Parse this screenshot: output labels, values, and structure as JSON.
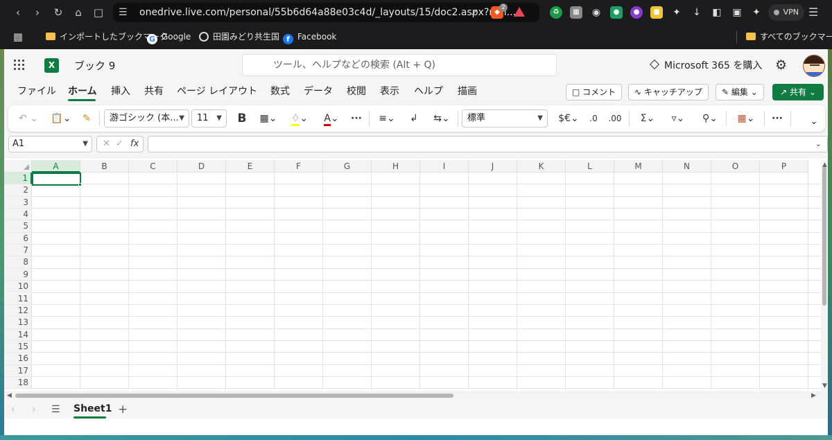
{
  "browser": {
    "url": "onedrive.live.com/personal/55b6d64a88e03c4d/_layouts/15/doc2.aspx?resi...",
    "brave_badge": "2",
    "vpn_label": "VPN",
    "bookmarks": [
      {
        "label": "インポートしたブックマーク"
      },
      {
        "label": "Google"
      },
      {
        "label": "田園みどり共生国"
      },
      {
        "label": "Facebook"
      }
    ],
    "all_bookmarks": "すべてのブックマーク"
  },
  "app": {
    "doc_name": "ブック 9",
    "search_placeholder": "ツール、ヘルプなどの検索 (Alt + Q)",
    "buy_label": "Microsoft 365 を購入",
    "tabs": [
      "ファイル",
      "ホーム",
      "挿入",
      "共有",
      "ページ レイアウト",
      "数式",
      "データ",
      "校閲",
      "表示",
      "ヘルプ",
      "描画"
    ],
    "active_tab": "ホーム",
    "comment_label": "コメント",
    "catchup_label": "キャッチアップ",
    "edit_label": "編集",
    "share_label": "共有",
    "colors": {
      "accent": "#107c41",
      "fill_highlight": "#ffff00",
      "font_red": "#e00000"
    }
  },
  "ribbon": {
    "font_name": "游ゴシック (本...",
    "font_size": "11",
    "bold_label": "B",
    "number_format": "標準",
    "currency_label": "$€",
    "more_label": "···"
  },
  "formula_bar": {
    "name_box": "A1",
    "fx_label": "fx",
    "value": ""
  },
  "grid": {
    "columns": [
      "A",
      "B",
      "C",
      "D",
      "E",
      "F",
      "G",
      "H",
      "I",
      "J",
      "K",
      "L",
      "M",
      "N",
      "O",
      "P"
    ],
    "rows": [
      "1",
      "2",
      "3",
      "4",
      "5",
      "6",
      "7",
      "8",
      "9",
      "10",
      "11",
      "12",
      "13",
      "14",
      "15",
      "16",
      "17",
      "18"
    ],
    "selected_cell": "A1"
  },
  "sheets": {
    "tabs": [
      "Sheet1"
    ],
    "add_label": "+"
  }
}
